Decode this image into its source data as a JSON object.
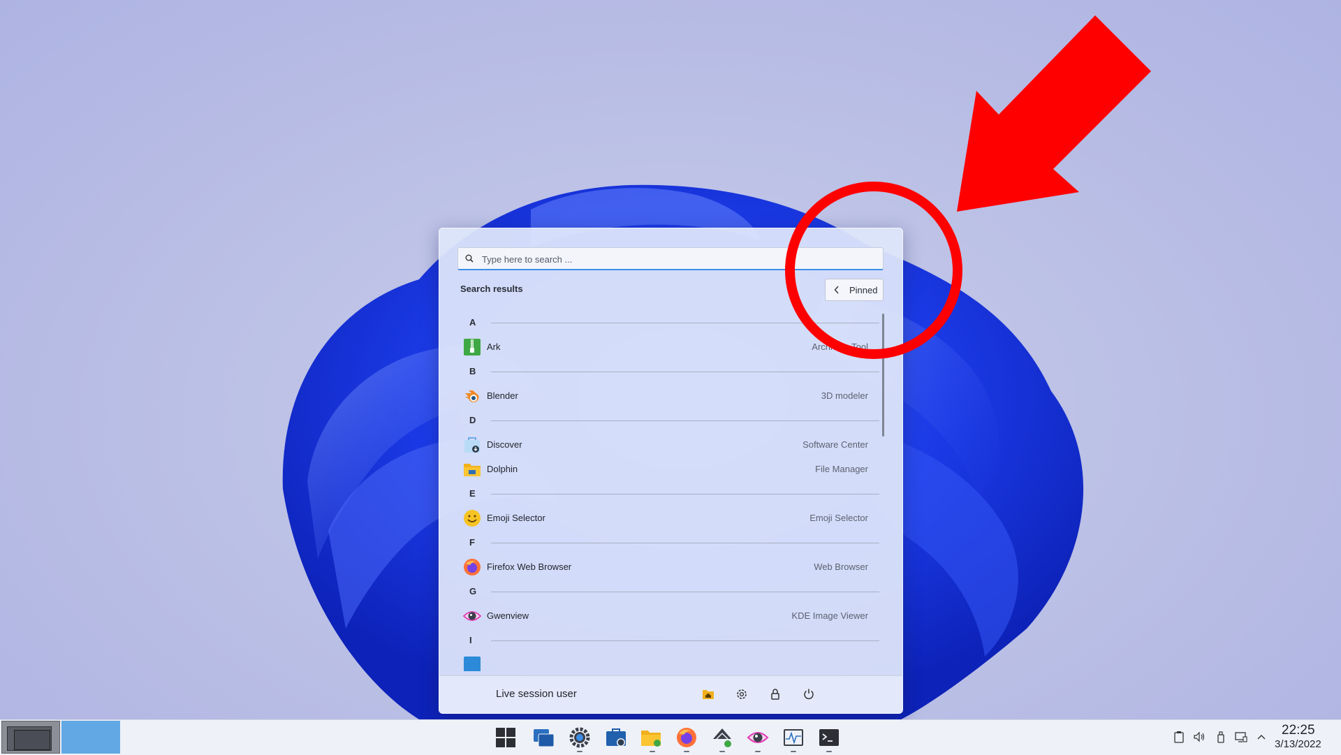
{
  "search": {
    "placeholder": "Type here to search ..."
  },
  "section_title": "Search results",
  "pinned_button": {
    "label": "Pinned"
  },
  "app_list": [
    {
      "letter": "A"
    },
    {
      "name": "Ark",
      "desc": "Archiving Tool",
      "icon": "ark-icon"
    },
    {
      "letter": "B"
    },
    {
      "name": "Blender",
      "desc": "3D modeler",
      "icon": "blender-icon"
    },
    {
      "letter": "D"
    },
    {
      "name": "Discover",
      "desc": "Software Center",
      "icon": "discover-icon"
    },
    {
      "name": "Dolphin",
      "desc": "File Manager",
      "icon": "dolphin-icon"
    },
    {
      "letter": "E"
    },
    {
      "name": "Emoji Selector",
      "desc": "Emoji Selector",
      "icon": "emoji-icon"
    },
    {
      "letter": "F"
    },
    {
      "name": "Firefox Web Browser",
      "desc": "Web Browser",
      "icon": "firefox-icon"
    },
    {
      "letter": "G"
    },
    {
      "name": "Gwenview",
      "desc": "KDE Image Viewer",
      "icon": "gwenview-icon"
    },
    {
      "letter": "I"
    },
    {
      "name": "",
      "desc": "",
      "icon": "partial-app-icon"
    }
  ],
  "footer": {
    "user": "Live session user",
    "buttons": [
      "home-folder-icon",
      "settings-icon",
      "lock-icon",
      "power-icon"
    ]
  },
  "taskbar": {
    "pinned": [
      "start-menu-icon",
      "task-switcher-icon",
      "system-settings-icon",
      "discover-icon",
      "dolphin-icon",
      "firefox-icon",
      "network-icon",
      "gwenview-icon",
      "system-monitor-icon",
      "terminal-icon"
    ],
    "tray": [
      "clipboard-icon",
      "volume-icon",
      "usb-icon",
      "network-monitor-icon",
      "expand-tray-icon"
    ],
    "time": "22:25",
    "date": "3/13/2022"
  },
  "colors": {
    "accent": "#3d8ee6",
    "annotation": "#ff0000"
  }
}
